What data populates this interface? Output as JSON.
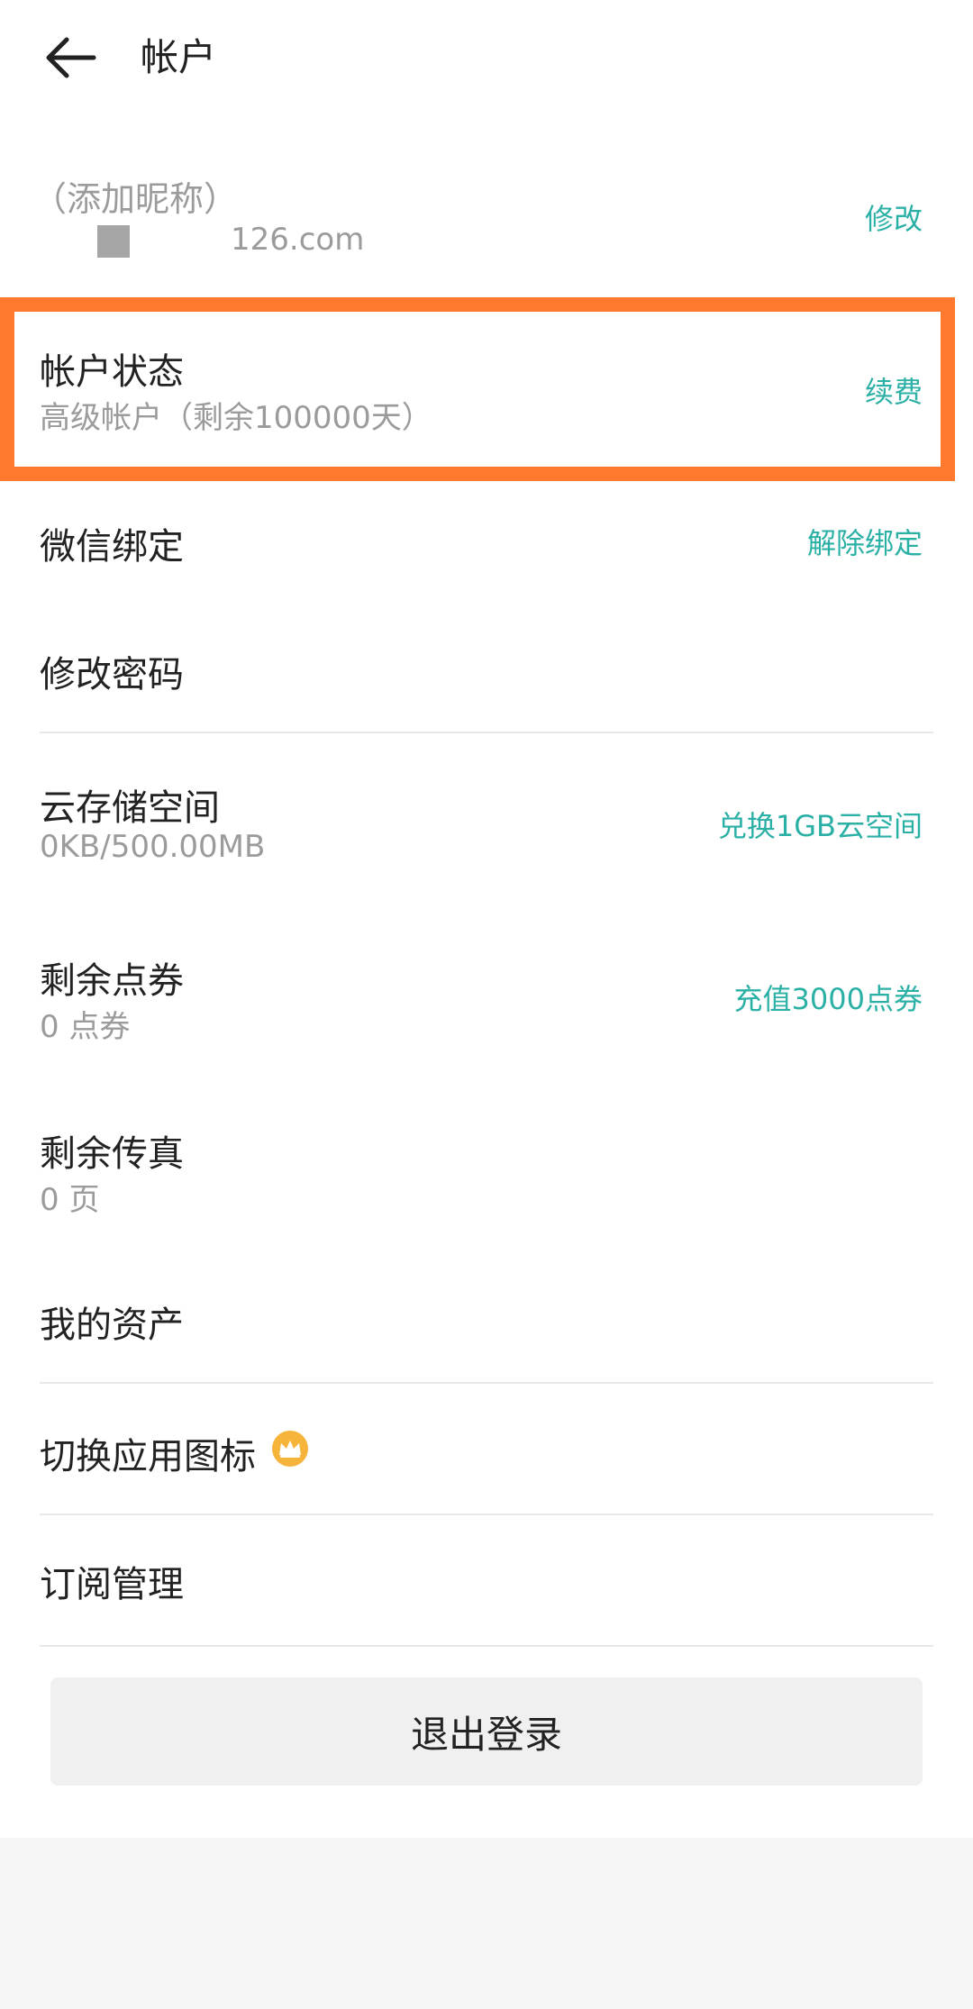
{
  "header": {
    "title": "帐户",
    "back_icon": "arrow-left-icon"
  },
  "profile": {
    "nickname": "（添加昵称）",
    "email": "126.com",
    "action": "修改"
  },
  "account_status": {
    "title": "帐户状态",
    "subtitle": "高级帐户（剩余100000天）",
    "action": "续费"
  },
  "wechat": {
    "title": "微信绑定",
    "action": "解除绑定"
  },
  "password": {
    "title": "修改密码"
  },
  "cloud_storage": {
    "title": "云存储空间",
    "subtitle": "0KB/500.00MB",
    "action": "兑换1GB云空间"
  },
  "coupons": {
    "title": "剩余点券",
    "subtitle": "0 点券",
    "action": "充值3000点券"
  },
  "fax": {
    "title": "剩余传真",
    "subtitle": "0 页"
  },
  "assets": {
    "title": "我的资产"
  },
  "app_icon": {
    "title": "切换应用图标",
    "icon": "crown-icon"
  },
  "subscription": {
    "title": "订阅管理"
  },
  "logout": {
    "label": "退出登录"
  },
  "colors": {
    "accent": "#2bb0a6",
    "highlight": "#ff7a2f",
    "crown": "#f6b43a"
  }
}
